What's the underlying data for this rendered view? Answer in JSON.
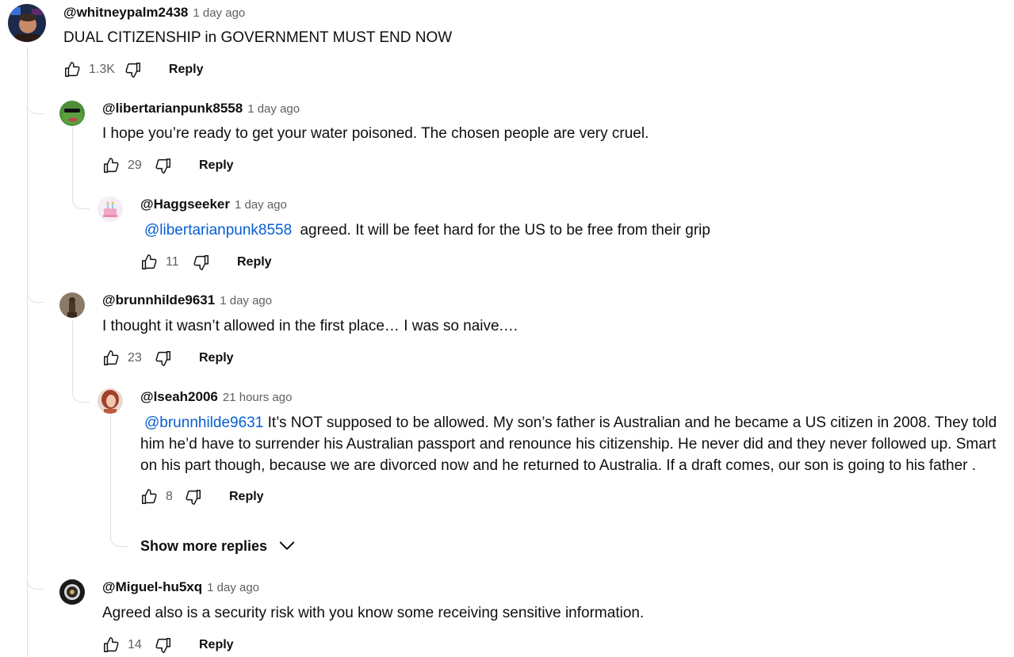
{
  "comments": [
    {
      "author": "@whitneypalm2438",
      "time": "1 day ago",
      "text": "DUAL CITIZENSHIP in GOVERNMENT MUST END NOW",
      "likes": "1.3K",
      "reply_label": "Reply"
    },
    {
      "author": "@libertarianpunk8558",
      "time": "1 day ago",
      "text": "I hope you’re ready to get your water poisoned. The chosen people are very cruel.",
      "likes": "29",
      "reply_label": "Reply"
    },
    {
      "author": "@Haggseeker",
      "time": "1 day ago",
      "mention": "@libertarianpunk8558",
      "text": "agreed. It will be feet hard for the US to be free from their grip",
      "likes": "11",
      "reply_label": "Reply"
    },
    {
      "author": "@brunnhilde9631",
      "time": "1 day ago",
      "text": "I thought it wasn’t allowed in the first place… I was so naive.…",
      "likes": "23",
      "reply_label": "Reply"
    },
    {
      "author": "@lseah2006",
      "time": "21 hours ago",
      "mention": "@brunnhilde9631",
      "text": "It’s NOT supposed to be allowed. My son’s father is Australian and he became a US citizen in 2008. They told him he’d have to surrender his Australian passport and renounce his citizenship. He never did and they never followed up.  Smart on his part though, because we are divorced now and he returned to Australia. If a draft comes, our son is going to his father .",
      "likes": "8",
      "reply_label": "Reply"
    },
    {
      "author": "@Miguel-hu5xq",
      "time": "1 day ago",
      "text": "Agreed also is a security risk with you know some receiving sensitive information.",
      "likes": "14",
      "reply_label": "Reply"
    }
  ],
  "show_more_replies": "Show more replies",
  "colors": {
    "mention": "#065fd4",
    "meta_text": "#606060",
    "thread_line": "#e0e0e0"
  },
  "icons": {
    "like": "thumbs-up-icon",
    "dislike": "thumbs-down-icon",
    "expand": "chevron-down-icon"
  }
}
